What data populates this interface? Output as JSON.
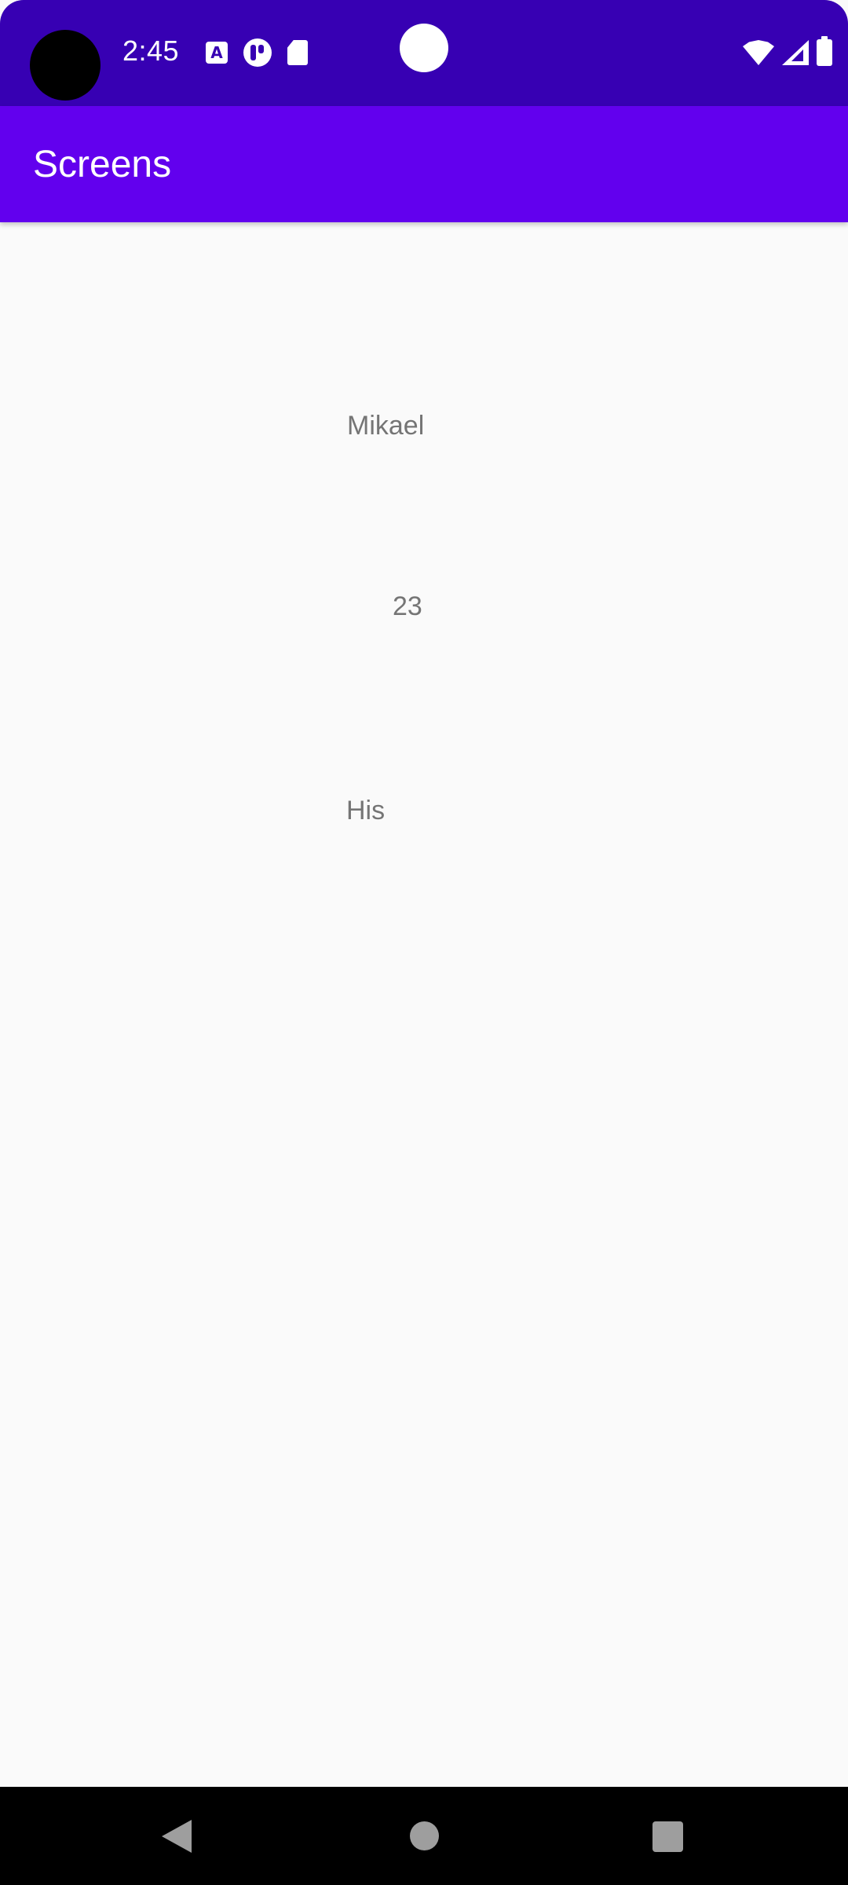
{
  "status_bar": {
    "time": "2:45",
    "notification_icons": [
      "a-letter-icon",
      "pill-app-icon",
      "sd-card-icon"
    ],
    "system_icons": [
      "wifi-icon",
      "cell-signal-icon",
      "battery-icon"
    ],
    "background_color": "#3700B3"
  },
  "app_bar": {
    "title": "Screens",
    "background_color": "#6200EE"
  },
  "content": {
    "name": "Mikael",
    "age": "23",
    "pronoun": "His",
    "text_color": "#757575"
  },
  "nav_bar": {
    "buttons": [
      "back-icon",
      "home-icon",
      "recents-icon"
    ]
  }
}
